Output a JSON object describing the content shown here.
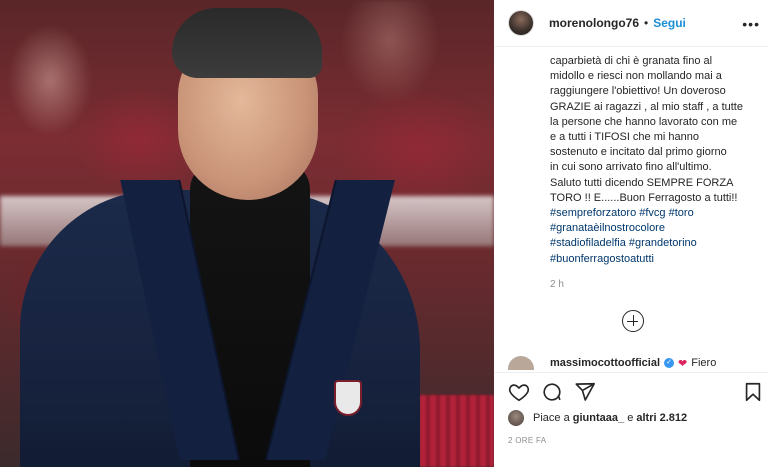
{
  "post": {
    "username": "morenolongo76",
    "separator": "•",
    "follow_label": "Segui",
    "more_icon": "more-options-icon"
  },
  "caption": {
    "line1": "caparbietà di chi è granata fino al",
    "line2": "midollo e riesci non mollando mai a",
    "line3": "raggiungere l'obiettivo! Un doveroso",
    "line4": "GRAZIE ai ragazzi , al mio staff , a tutte",
    "line5": "la persone che hanno lavorato con me",
    "line6": "e a tutti i TIFOSI che mi hanno",
    "line7": "sostenuto e incitato dal primo giorno",
    "line8": "in cui sono arrivato fino all'ultimo.",
    "line9": "Saluto tutti dicendo SEMPRE FORZA",
    "line10": "TORO !! E......Buon Ferragosto a tutti!!",
    "tags1": "#sempreforzatoro #fvcg #toro",
    "tags2": "#granataèilnostrocolore",
    "tags3": "#stadiofiladelfia #grandetorino",
    "tags4": "#buonferragostoatutti",
    "time": "2 h"
  },
  "comment": {
    "username": "massimocottoofficial",
    "verified_icon": "verified-badge-icon",
    "text": "Fiero"
  },
  "actions": {
    "like_icon": "heart-icon",
    "comment_icon": "comment-icon",
    "share_icon": "share-icon",
    "save_icon": "bookmark-icon"
  },
  "likes": {
    "prefix": "Piace a",
    "user": "giuntaaa_",
    "middle": "e",
    "count_text": "altri 2.812"
  },
  "posted_ago": "2 ORE FA"
}
